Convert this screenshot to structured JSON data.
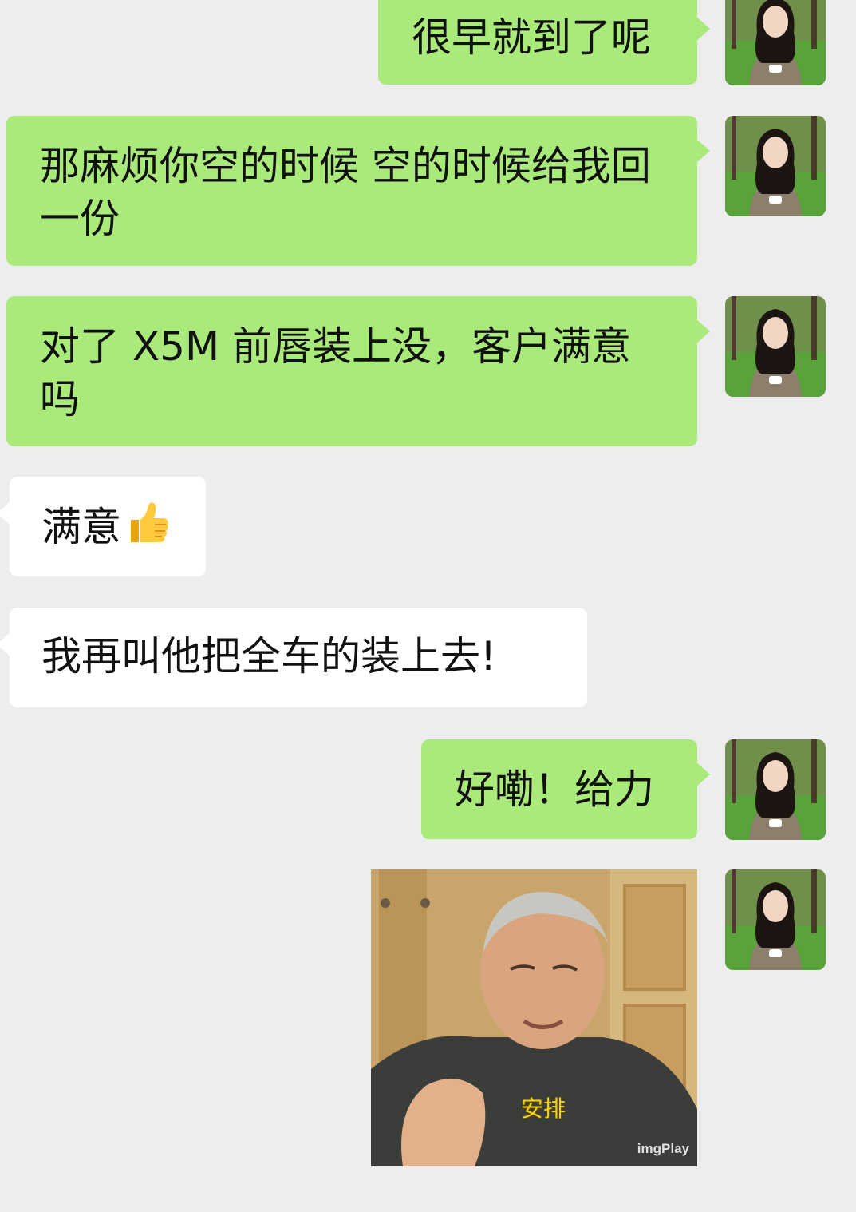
{
  "messages": [
    {
      "id": 1,
      "side": "out",
      "text": "很早就到了呢"
    },
    {
      "id": 2,
      "side": "out",
      "text": "那麻烦你空的时候 空的时候给我回一份"
    },
    {
      "id": 3,
      "side": "out",
      "text": "对了 X5M 前唇装上没，客户满意吗"
    },
    {
      "id": 4,
      "side": "in",
      "text": "满意",
      "emoji": "thumbs-up-icon"
    },
    {
      "id": 5,
      "side": "in",
      "text": "我再叫他把全车的装上去!"
    },
    {
      "id": 6,
      "side": "out",
      "text": "好嘞！给力"
    },
    {
      "id": 7,
      "side": "out",
      "type": "sticker",
      "caption": "安排",
      "watermark": "imgPlay"
    }
  ],
  "colors": {
    "background": "#ededed",
    "outgoing_bubble": "#a9ea7a",
    "incoming_bubble": "#ffffff"
  }
}
